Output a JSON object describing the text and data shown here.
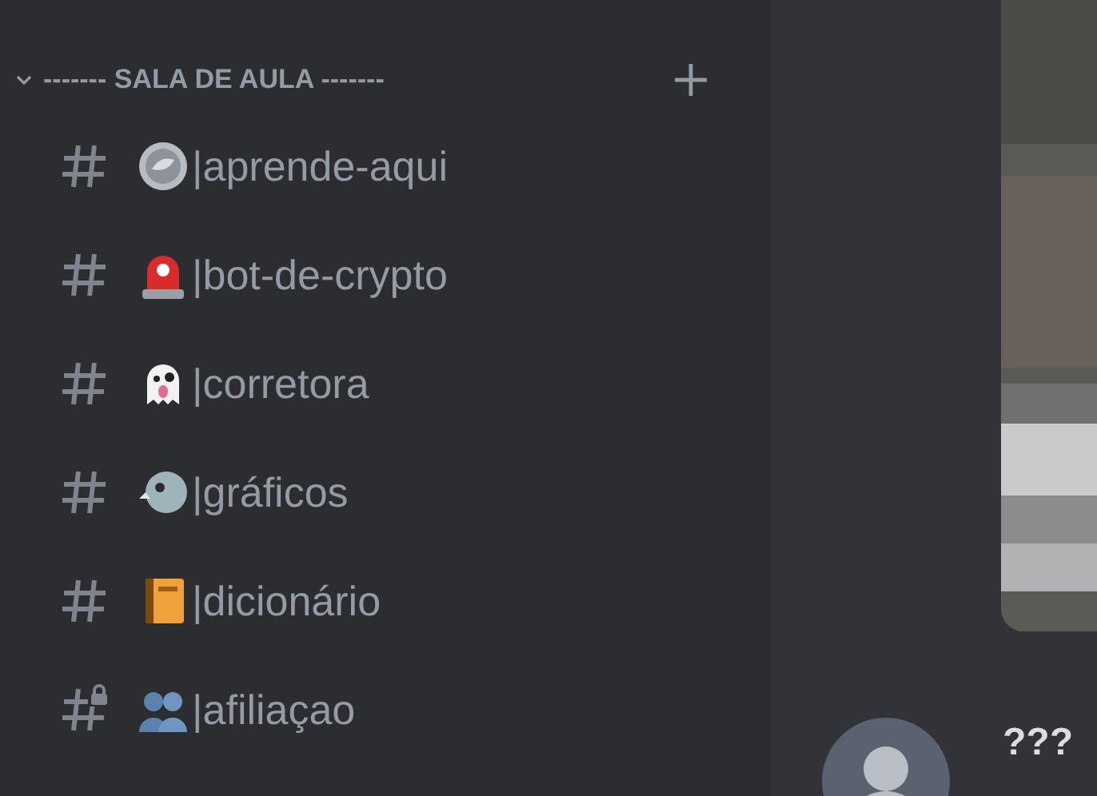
{
  "category": {
    "title": "------- SALA DE AULA -------",
    "expanded": true
  },
  "channels": [
    {
      "name": "|aprende-aqui",
      "locked": false
    },
    {
      "name": "|bot-de-crypto",
      "locked": false
    },
    {
      "name": "|corretora",
      "locked": false
    },
    {
      "name": "|gráficos",
      "locked": false
    },
    {
      "name": "|dicionário",
      "locked": false
    },
    {
      "name": "|afiliaçao",
      "locked": true
    }
  ],
  "message": {
    "text": "???"
  }
}
